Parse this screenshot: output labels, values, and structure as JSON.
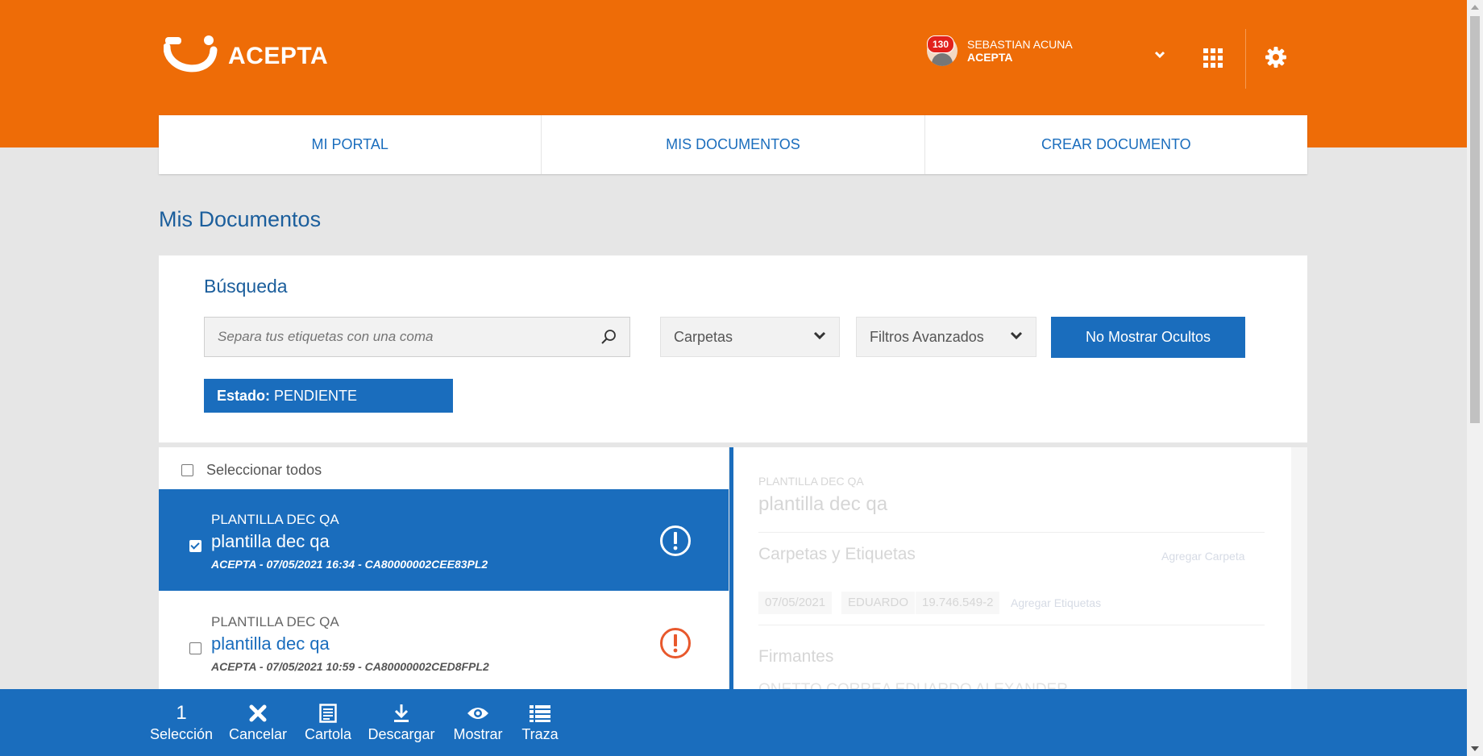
{
  "header": {
    "brand": "ACEPTA",
    "notifications_count": "130",
    "user_name": "SEBASTIAN ACUNA",
    "user_org": "ACEPTA",
    "accent_color": "#ee6c07"
  },
  "nav": {
    "tabs": [
      {
        "label": "MI PORTAL"
      },
      {
        "label": "MIS DOCUMENTOS"
      },
      {
        "label": "CREAR DOCUMENTO"
      }
    ]
  },
  "page": {
    "title": "Mis Documentos"
  },
  "search": {
    "title": "Búsqueda",
    "placeholder": "Separa tus etiquetas con una coma",
    "folders_label": "Carpetas",
    "filters_label": "Filtros Avanzados",
    "hide_button": "No Mostrar Ocultos",
    "state_chip_key": "Estado:",
    "state_chip_value": "PENDIENTE"
  },
  "list": {
    "select_all": "Seleccionar todos",
    "items": [
      {
        "kicker": "PLANTILLA DEC QA",
        "title": "plantilla dec qa",
        "meta": "ACEPTA - 07/05/2021 16:34 - CA80000002CEE83PL2",
        "selected": true
      },
      {
        "kicker": "PLANTILLA DEC QA",
        "title": "plantilla dec qa",
        "meta": "ACEPTA - 07/05/2021 10:59 - CA80000002CED8FPL2",
        "selected": false
      }
    ]
  },
  "detail": {
    "kicker": "PLANTILLA DEC QA",
    "title": "plantilla dec qa",
    "folders_section": "Carpetas y Etiquetas",
    "add_folder": "Agregar Carpeta",
    "tags": [
      "07/05/2021",
      "EDUARDO",
      "19.746.549-2"
    ],
    "add_tags": "Agregar Etiquetas",
    "signers_section": "Firmantes",
    "signer_name": "ONETTO CORREA EDUARDO ALEXANDER"
  },
  "actions": {
    "selection_count": "1",
    "selection_label": "Selección",
    "cancel": "Cancelar",
    "cartola": "Cartola",
    "download": "Descargar",
    "show": "Mostrar",
    "trace": "Traza"
  }
}
